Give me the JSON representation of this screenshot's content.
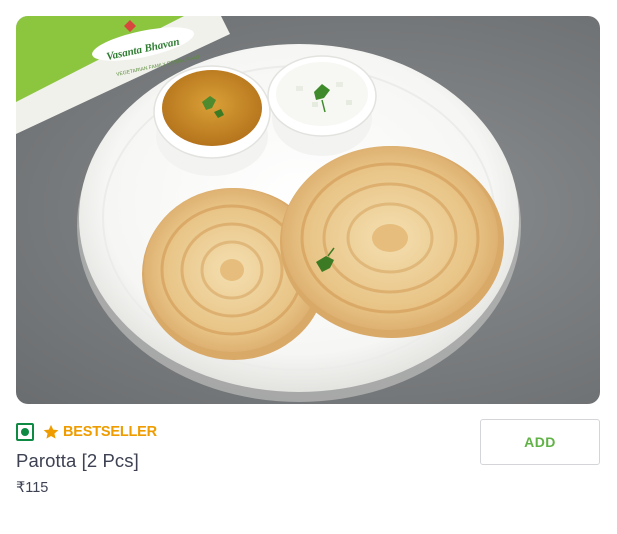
{
  "item": {
    "photo_alt": "Parotta [2 Pcs]",
    "brand_card": {
      "line1": "Vasanta Bhavan",
      "line2": "VEGETARIAN FAMILY RESTAURANT"
    },
    "badge": {
      "veg": true,
      "star_icon": "star-icon",
      "label": "BESTSELLER"
    },
    "name": "Parotta [2 Pcs]",
    "price": "₹115",
    "add_label": "ADD"
  },
  "colors": {
    "veg_green": "#0f8a43",
    "bestseller_orange": "#ee9c00",
    "add_green": "#60b246",
    "text_dark": "#3d4152",
    "border_gray": "#d4d5d9"
  }
}
